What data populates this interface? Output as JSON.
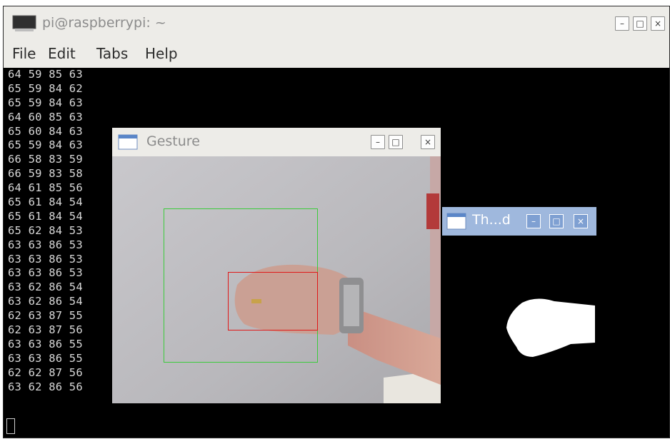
{
  "terminal": {
    "title": "pi@raspberrypi: ~",
    "menu": [
      "File",
      "Edit",
      "Tabs",
      "Help"
    ],
    "lines": [
      "64 59 85 63",
      "65 59 84 62",
      "65 59 84 63",
      "64 60 85 63",
      "65 60 84 63",
      "65 59 84 63",
      "66 58 83 59",
      "66 59 83 58",
      "64 61 85 56",
      "65 61 84 54",
      "65 61 84 54",
      "65 62 84 53",
      "63 63 86 53",
      "63 63 86 53",
      "63 63 86 53",
      "63 62 86 54",
      "63 62 86 54",
      "62 63 87 55",
      "62 63 87 56",
      "63 63 86 55",
      "63 63 86 55",
      "62 62 87 56",
      "63 62 86 56"
    ],
    "buttons": {
      "minimize": "–",
      "maximize": "□",
      "close": "×"
    }
  },
  "gesture_window": {
    "title": "Gesture",
    "buttons": {
      "minimize": "–",
      "maximize": "□",
      "close": "×"
    },
    "colors": {
      "roi_box": "#3ccb3c",
      "hand_box": "#e01818"
    }
  },
  "threshold_window": {
    "title": "Th...d",
    "buttons": {
      "minimize": "–",
      "maximize": "□",
      "close": "×"
    }
  }
}
